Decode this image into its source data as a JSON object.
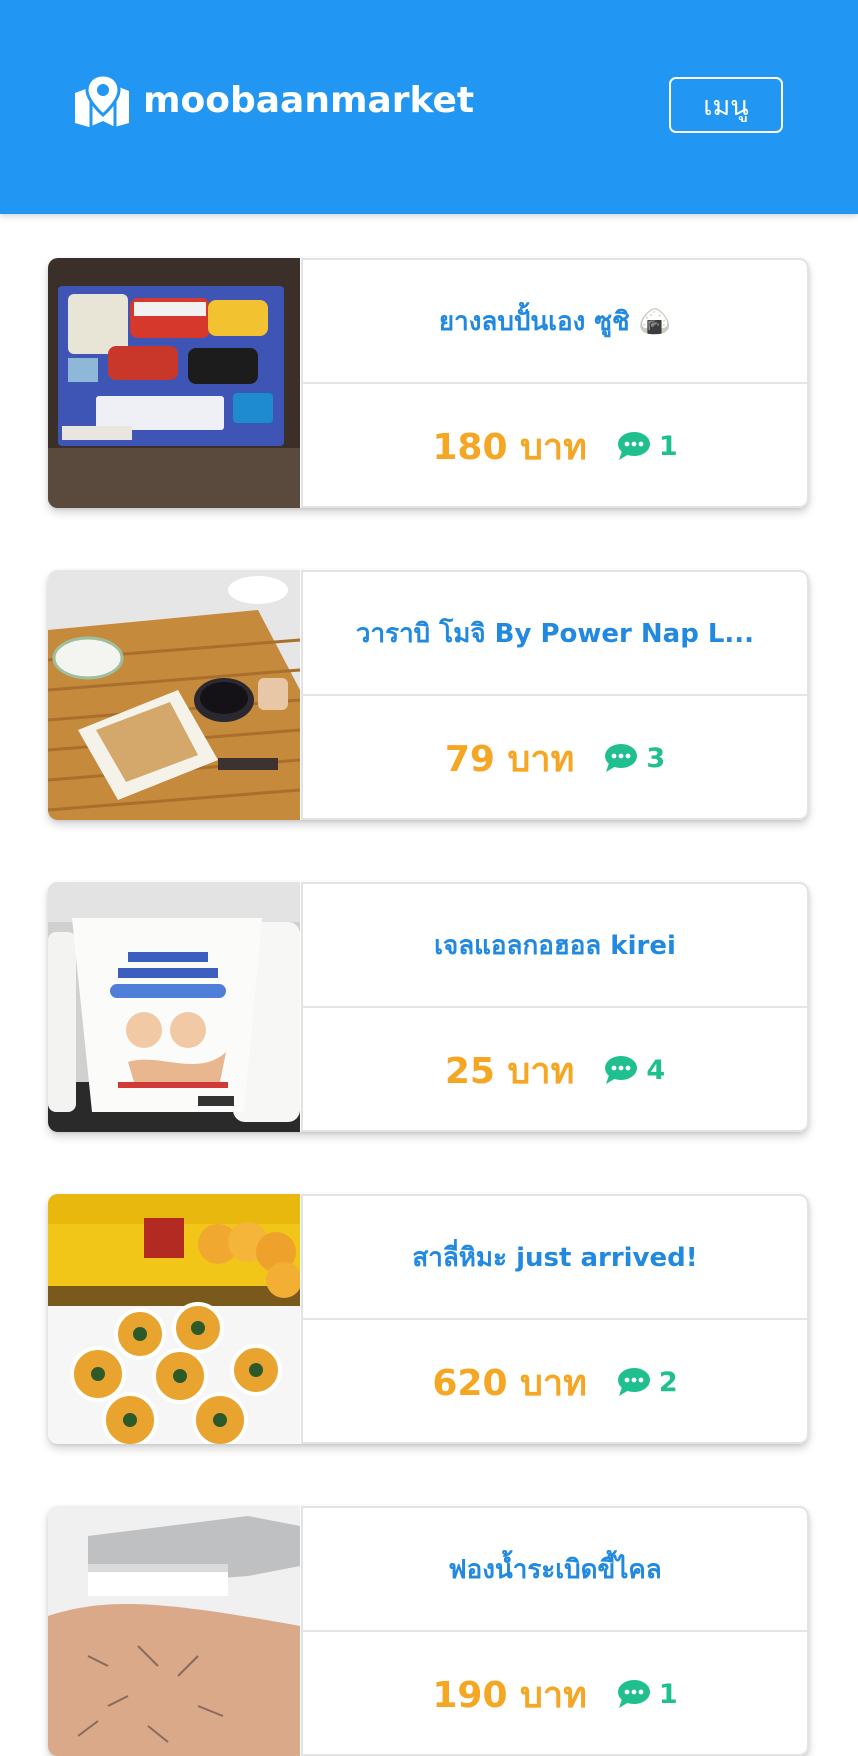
{
  "header": {
    "brand_name": "moobaanmarket",
    "menu_label": "เมนู",
    "background_color": "#2196f3"
  },
  "products": [
    {
      "title": "ยางลบปั้นเอง ซูชิ 🍙",
      "price": "180 บาท",
      "comment_count": "1",
      "image_subject": "sushi-eraser-kit"
    },
    {
      "title": "วาราบิ โมจิ By Power Nap L...",
      "price": "79 บาท",
      "comment_count": "3",
      "image_subject": "warabi-mochi"
    },
    {
      "title": "เจลแอลกอฮอล kirei",
      "price": "25 บาท",
      "comment_count": "4",
      "image_subject": "kirei-hand-sanitizer"
    },
    {
      "title": "สาลี่หิมะ just arrived!",
      "price": "620 บาท",
      "comment_count": "2",
      "image_subject": "snow-pears-box"
    },
    {
      "title": "ฟองน้ำระเบิดขี้ไคล",
      "price": "190 บาท",
      "comment_count": "1",
      "image_subject": "exfoliating-sponge"
    }
  ],
  "colors": {
    "title": "#2189e0",
    "price": "#f5a623",
    "comment": "#1fbf8f"
  }
}
